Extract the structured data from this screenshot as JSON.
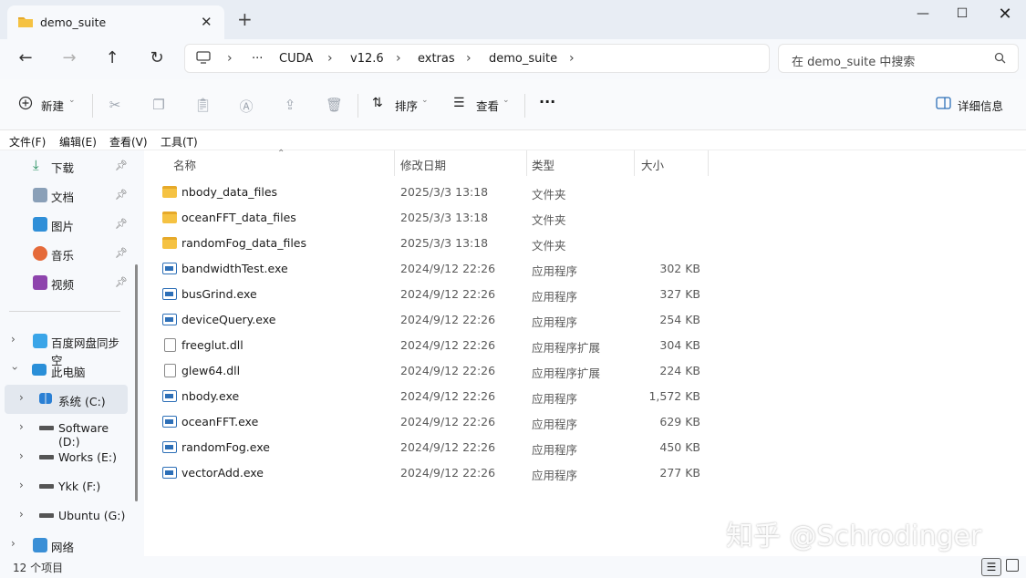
{
  "window": {
    "tab_title": "demo_suite",
    "min_glyph": "—",
    "max_glyph": "☐",
    "close_glyph": "✕"
  },
  "address": {
    "overflow": "···",
    "crumbs": [
      "CUDA",
      "v12.6",
      "extras",
      "demo_suite"
    ]
  },
  "search": {
    "placeholder": "在 demo_suite 中搜索"
  },
  "toolbar": {
    "new_label": "新建",
    "sort_label": "排序",
    "view_label": "查看",
    "more_label": "···",
    "details_label": "详细信息"
  },
  "menu": [
    "文件(F)",
    "编辑(E)",
    "查看(V)",
    "工具(T)"
  ],
  "sidebar": {
    "quick": [
      {
        "label": "下载"
      },
      {
        "label": "文档"
      },
      {
        "label": "图片"
      },
      {
        "label": "音乐"
      },
      {
        "label": "视频"
      }
    ],
    "baidu": "百度网盘同步空",
    "thispc": "此电脑",
    "drives": [
      "系统 (C:)",
      "Software (D:)",
      "Works (E:)",
      "Ykk (F:)",
      "Ubuntu (G:)"
    ],
    "network": "网络"
  },
  "columns": {
    "name": "名称",
    "date": "修改日期",
    "type": "类型",
    "size": "大小"
  },
  "files": [
    {
      "name": "nbody_data_files",
      "date": "2025/3/3 13:18",
      "type": "文件夹",
      "size": "",
      "kind": "folder"
    },
    {
      "name": "oceanFFT_data_files",
      "date": "2025/3/3 13:18",
      "type": "文件夹",
      "size": "",
      "kind": "folder"
    },
    {
      "name": "randomFog_data_files",
      "date": "2025/3/3 13:18",
      "type": "文件夹",
      "size": "",
      "kind": "folder"
    },
    {
      "name": "bandwidthTest.exe",
      "date": "2024/9/12 22:26",
      "type": "应用程序",
      "size": "302 KB",
      "kind": "exe"
    },
    {
      "name": "busGrind.exe",
      "date": "2024/9/12 22:26",
      "type": "应用程序",
      "size": "327 KB",
      "kind": "exe"
    },
    {
      "name": "deviceQuery.exe",
      "date": "2024/9/12 22:26",
      "type": "应用程序",
      "size": "254 KB",
      "kind": "exe"
    },
    {
      "name": "freeglut.dll",
      "date": "2024/9/12 22:26",
      "type": "应用程序扩展",
      "size": "304 KB",
      "kind": "dll"
    },
    {
      "name": "glew64.dll",
      "date": "2024/9/12 22:26",
      "type": "应用程序扩展",
      "size": "224 KB",
      "kind": "dll"
    },
    {
      "name": "nbody.exe",
      "date": "2024/9/12 22:26",
      "type": "应用程序",
      "size": "1,572 KB",
      "kind": "exe"
    },
    {
      "name": "oceanFFT.exe",
      "date": "2024/9/12 22:26",
      "type": "应用程序",
      "size": "629 KB",
      "kind": "exe"
    },
    {
      "name": "randomFog.exe",
      "date": "2024/9/12 22:26",
      "type": "应用程序",
      "size": "450 KB",
      "kind": "exe"
    },
    {
      "name": "vectorAdd.exe",
      "date": "2024/9/12 22:26",
      "type": "应用程序",
      "size": "277 KB",
      "kind": "exe"
    }
  ],
  "status": {
    "count": "12 个项目"
  },
  "watermark": "知乎 @Schrodinger"
}
